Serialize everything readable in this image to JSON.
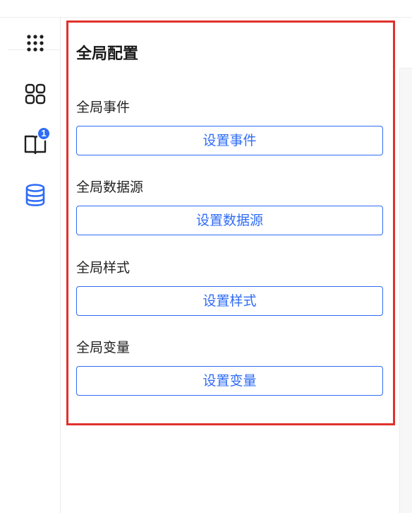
{
  "panel": {
    "title": "全局配置",
    "sections": [
      {
        "label": "全局事件",
        "button": "设置事件"
      },
      {
        "label": "全局数据源",
        "button": "设置数据源"
      },
      {
        "label": "全局样式",
        "button": "设置样式"
      },
      {
        "label": "全局变量",
        "button": "设置变量"
      }
    ]
  },
  "rail": {
    "items": [
      {
        "icon": "apps-grid-icon"
      },
      {
        "icon": "components-icon"
      },
      {
        "icon": "book-icon",
        "badge": "1"
      },
      {
        "icon": "database-icon",
        "active": true
      }
    ]
  },
  "colors": {
    "accent": "#2f6cf6",
    "highlight_outline": "#e0312b"
  }
}
